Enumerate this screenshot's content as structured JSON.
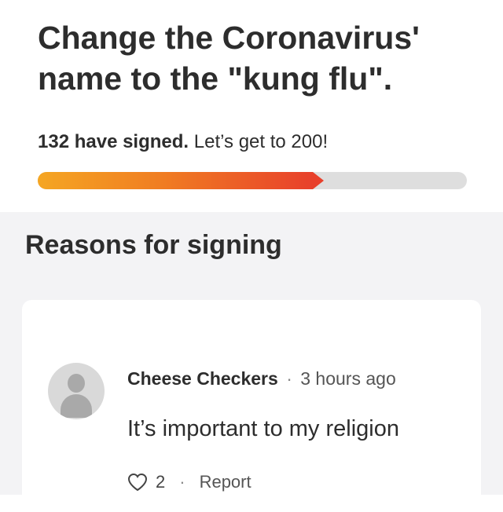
{
  "petition": {
    "title_line1": "Change the Coronavirus'",
    "title_line2": "name to the \"kung flu\".",
    "signed_count_text": "132 have signed.",
    "goal_text": "Let’s get to 200!",
    "signatures": 132,
    "goal": 200,
    "progress_fraction": 0.66,
    "progress_colors": [
      "#f5a623",
      "#f07d22",
      "#e8402b"
    ],
    "track_color": "#dedede"
  },
  "reasons": {
    "section_title": "Reasons for signing",
    "comments": [
      {
        "author": "Cheese Checkers",
        "separator": "·",
        "time": "3 hours ago",
        "text": "It’s important to my religion",
        "likes": "2",
        "like_icon": "heart-outline-icon",
        "report_label": "Report"
      }
    ]
  }
}
